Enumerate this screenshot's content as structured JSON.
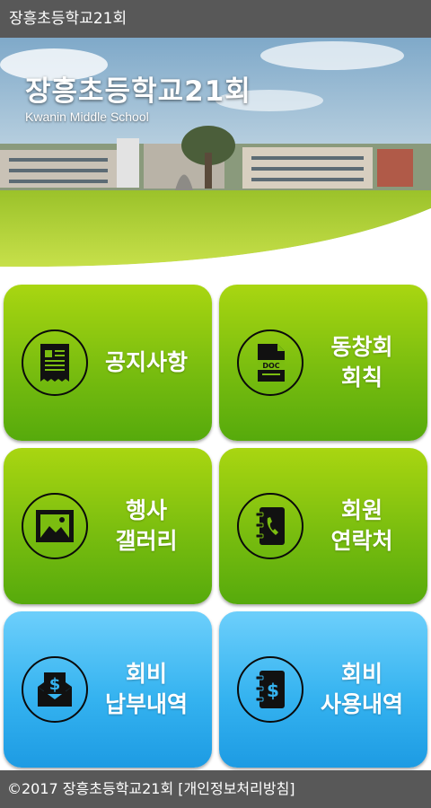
{
  "app": {
    "title": "장흥초등학교21회"
  },
  "hero": {
    "title": "장흥초등학교21회",
    "subtitle": "Kwanin Middle School"
  },
  "menu": [
    {
      "lines": [
        "공지사항"
      ],
      "icon": "notice-document-icon",
      "color": "green"
    },
    {
      "lines": [
        "동창회",
        "회칙"
      ],
      "icon": "doc-file-icon",
      "color": "green"
    },
    {
      "lines": [
        "행사",
        "갤러리"
      ],
      "icon": "gallery-picture-icon",
      "color": "green"
    },
    {
      "lines": [
        "회원",
        "연락처"
      ],
      "icon": "phone-book-icon",
      "color": "green"
    },
    {
      "lines": [
        "회비",
        "납부내역"
      ],
      "icon": "dollar-envelope-icon",
      "color": "blue"
    },
    {
      "lines": [
        "회비",
        "사용내역"
      ],
      "icon": "dollar-notebook-icon",
      "color": "blue"
    }
  ],
  "footer": {
    "copyright": "©2017 장흥초등학교21회 ",
    "privacy_link": "[개인정보처리방침]"
  },
  "colors": {
    "bar": "#585858",
    "green_tile": "#79bd0f",
    "blue_tile": "#35b3f0"
  }
}
